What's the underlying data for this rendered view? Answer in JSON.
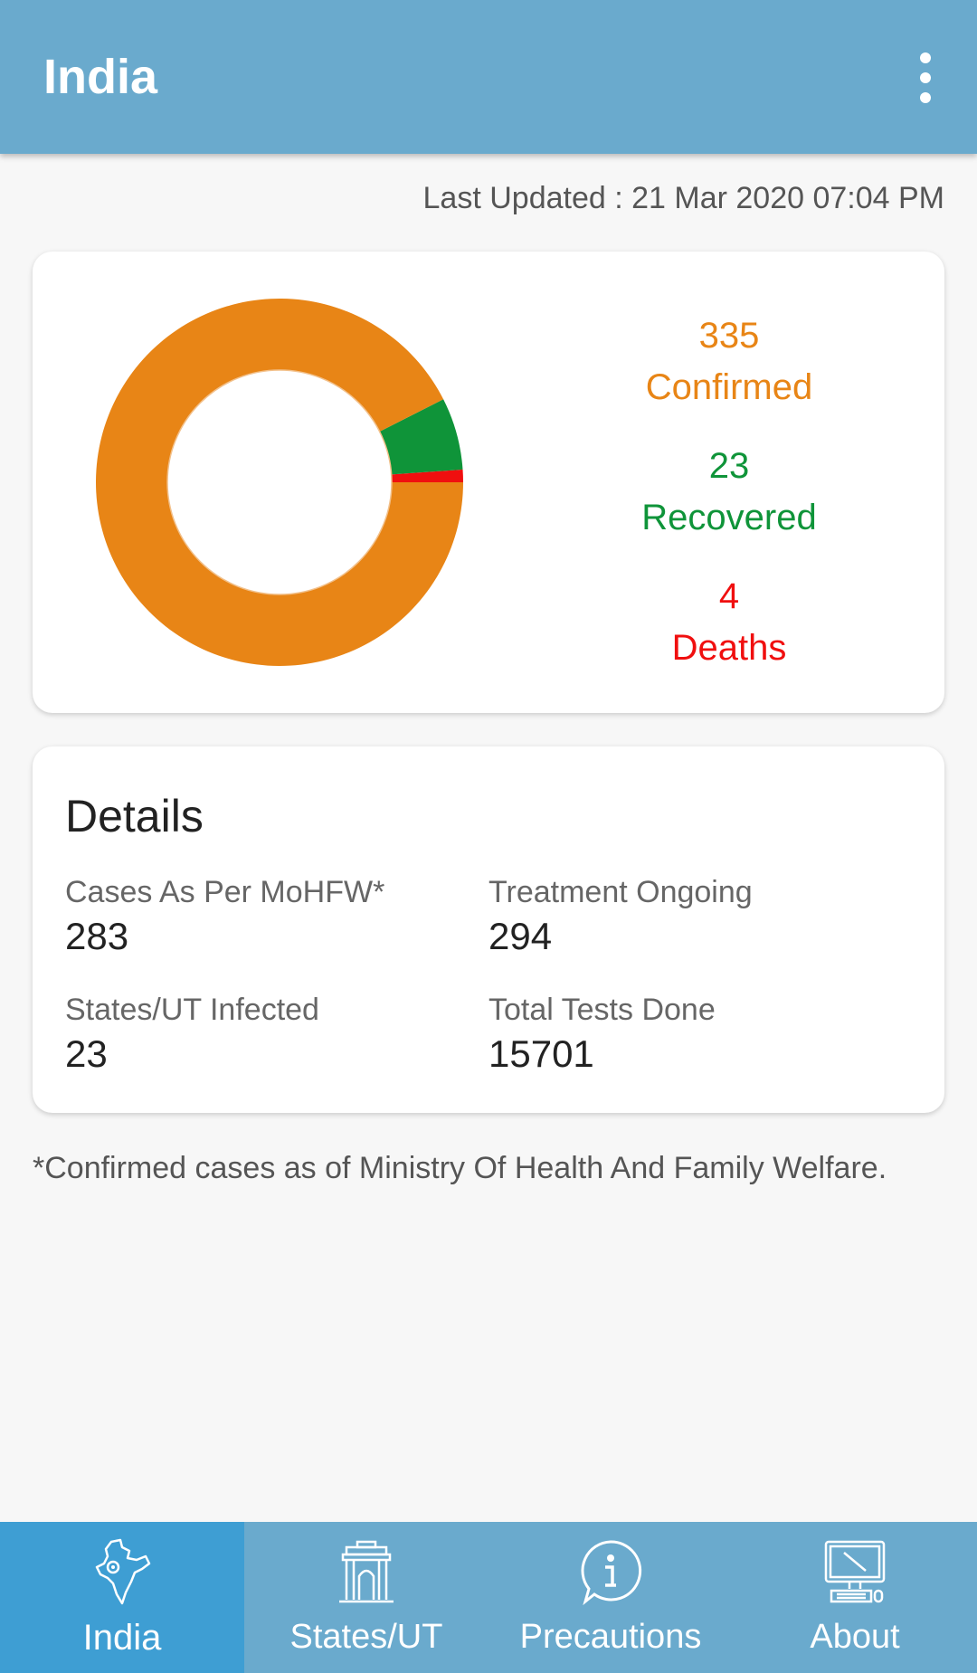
{
  "app_bar": {
    "title": "India"
  },
  "last_updated": "Last Updated : 21 Mar 2020 07:04 PM",
  "summary": {
    "confirmed": {
      "value": "335",
      "label": "Confirmed"
    },
    "recovered": {
      "value": "23",
      "label": "Recovered"
    },
    "deaths": {
      "value": "4",
      "label": "Deaths"
    }
  },
  "chart_data": {
    "type": "pie",
    "categories": [
      "Confirmed",
      "Recovered",
      "Deaths"
    ],
    "values": [
      335,
      23,
      4
    ],
    "colors": [
      "#e88516",
      "#0f9439",
      "#f00f0f"
    ]
  },
  "details": {
    "title": "Details",
    "items": [
      {
        "label": "Cases As Per MoHFW*",
        "value": "283"
      },
      {
        "label": "Treatment Ongoing",
        "value": "294"
      },
      {
        "label": "States/UT Infected",
        "value": "23"
      },
      {
        "label": "Total Tests Done",
        "value": "15701"
      }
    ]
  },
  "footnote": "*Confirmed cases as of Ministry Of Health And Family Welfare.",
  "bottom_nav": {
    "items": [
      {
        "label": "India",
        "icon": "india-map-icon"
      },
      {
        "label": "States/UT",
        "icon": "india-gate-icon"
      },
      {
        "label": "Precautions",
        "icon": "info-bubble-icon"
      },
      {
        "label": "About",
        "icon": "computer-icon"
      }
    ]
  },
  "colors": {
    "primary": "#6aaacd",
    "nav_active": "#3e9ed3"
  }
}
